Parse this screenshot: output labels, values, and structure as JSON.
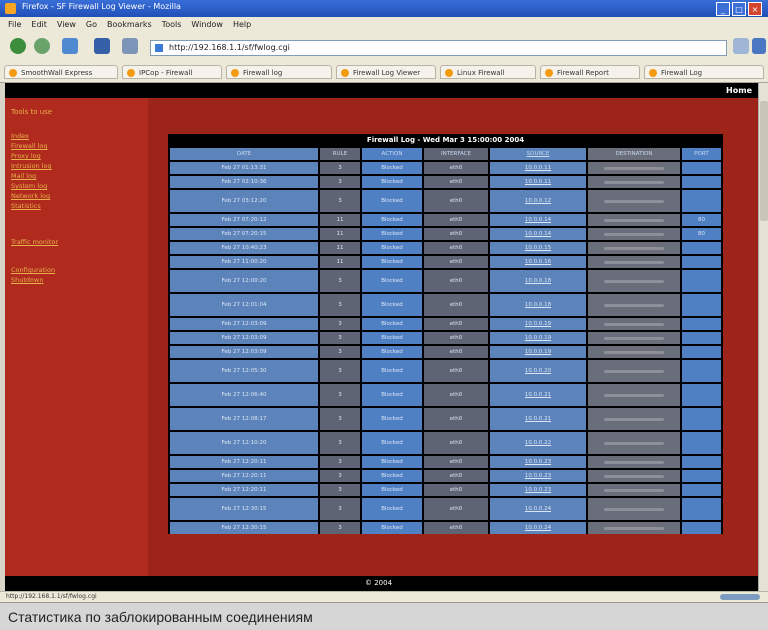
{
  "window": {
    "title": "Firefox - SF Firewall Log Viewer - Mozilla",
    "buttons": [
      "_",
      "□",
      "×"
    ]
  },
  "menu": [
    "File",
    "Edit",
    "View",
    "Go",
    "Bookmarks",
    "Tools",
    "Window",
    "Help"
  ],
  "address_bar": {
    "url": "http://192.168.1.1/sf/fwlog.cgi"
  },
  "tabs": [
    "SmoothWall Express",
    "IPCop - Firewall",
    "Firewall log",
    "Firewall Log Viewer",
    "Linux Firewall",
    "Firewall Report",
    "Firewall Log"
  ],
  "page": {
    "home_link": "Home",
    "sidebar_heading": "Tools to use",
    "sidebar_links": [
      "Index",
      "Firewall log",
      "Proxy log",
      "Intrusion log",
      "Mail log",
      "System log",
      "Network log",
      "Statistics",
      "Traffic monitor",
      "Configuration",
      "Shutdown"
    ],
    "log_title": "Firewall Log - Wed Mar 3 15:00:00 2004",
    "columns": [
      "DATE",
      "RULE",
      "ACTION",
      "INTERFACE",
      "SOURCE",
      "DESTINATION",
      "PORT"
    ],
    "rows": [
      {
        "date": "Feb 27 01:13:31",
        "rule": "3",
        "action": "Blocked",
        "iface": "eth0",
        "src": "10.0.0.11",
        "port": "",
        "tall": false
      },
      {
        "date": "Feb 27 02:10:36",
        "rule": "3",
        "action": "Blocked",
        "iface": "eth0",
        "src": "10.0.0.11",
        "port": "",
        "tall": false
      },
      {
        "date": "Feb 27 03:12:20",
        "rule": "3",
        "action": "Blocked",
        "iface": "eth0",
        "src": "10.0.0.12",
        "port": "",
        "tall": true
      },
      {
        "date": "Feb 27 07:20:12",
        "rule": "11",
        "action": "Blocked",
        "iface": "eth0",
        "src": "10.0.0.14",
        "port": "80",
        "tall": false
      },
      {
        "date": "Feb 27 07:20:15",
        "rule": "11",
        "action": "Blocked",
        "iface": "eth0",
        "src": "10.0.0.14",
        "port": "80",
        "tall": false
      },
      {
        "date": "Feb 27 10:40:23",
        "rule": "11",
        "action": "Blocked",
        "iface": "eth0",
        "src": "10.0.0.15",
        "port": "",
        "tall": false
      },
      {
        "date": "Feb 27 11:00:20",
        "rule": "11",
        "action": "Blocked",
        "iface": "eth0",
        "src": "10.0.0.16",
        "port": "",
        "tall": false
      },
      {
        "date": "Feb 27 12:00:20",
        "rule": "3",
        "action": "Blocked",
        "iface": "eth0",
        "src": "10.0.0.18",
        "port": "",
        "tall": true
      },
      {
        "date": "Feb 27 12:01:04",
        "rule": "3",
        "action": "Blocked",
        "iface": "eth0",
        "src": "10.0.0.18",
        "port": "",
        "tall": true
      },
      {
        "date": "Feb 27 12:03:09",
        "rule": "3",
        "action": "Blocked",
        "iface": "eth0",
        "src": "10.0.0.19",
        "port": "",
        "tall": false
      },
      {
        "date": "Feb 27 12:03:09",
        "rule": "3",
        "action": "Blocked",
        "iface": "eth0",
        "src": "10.0.0.19",
        "port": "",
        "tall": false
      },
      {
        "date": "Feb 27 12:03:09",
        "rule": "3",
        "action": "Blocked",
        "iface": "eth0",
        "src": "10.0.0.19",
        "port": "",
        "tall": false
      },
      {
        "date": "Feb 27 12:05:30",
        "rule": "3",
        "action": "Blocked",
        "iface": "eth0",
        "src": "10.0.0.20",
        "port": "",
        "tall": true
      },
      {
        "date": "Feb 27 12:06:40",
        "rule": "3",
        "action": "Blocked",
        "iface": "eth0",
        "src": "10.0.0.21",
        "port": "",
        "tall": true
      },
      {
        "date": "Feb 27 12:08:17",
        "rule": "3",
        "action": "Blocked",
        "iface": "eth0",
        "src": "10.0.0.21",
        "port": "",
        "tall": true
      },
      {
        "date": "Feb 27 12:10:20",
        "rule": "3",
        "action": "Blocked",
        "iface": "eth0",
        "src": "10.0.0.22",
        "port": "",
        "tall": true
      },
      {
        "date": "Feb 27 12:20:11",
        "rule": "3",
        "action": "Blocked",
        "iface": "eth0",
        "src": "10.0.0.23",
        "port": "",
        "tall": false
      },
      {
        "date": "Feb 27 12:20:11",
        "rule": "3",
        "action": "Blocked",
        "iface": "eth0",
        "src": "10.0.0.23",
        "port": "",
        "tall": false
      },
      {
        "date": "Feb 27 12:20:11",
        "rule": "3",
        "action": "Blocked",
        "iface": "eth0",
        "src": "10.0.0.23",
        "port": "",
        "tall": false
      },
      {
        "date": "Feb 27 12:30:15",
        "rule": "3",
        "action": "Blocked",
        "iface": "eth0",
        "src": "10.0.0.24",
        "port": "",
        "tall": true
      },
      {
        "date": "Feb 27 12:30:15",
        "rule": "3",
        "action": "Blocked",
        "iface": "eth0",
        "src": "10.0.0.24",
        "port": "",
        "tall": false
      }
    ],
    "footer": "© 2004"
  },
  "status_bar": {
    "text": "http://192.168.1.1/sf/fwlog.cgi"
  },
  "caption": "Статистика по заблокированным соединениям",
  "colors": {
    "page_bg": "#b02a1e",
    "link": "#e7b14a",
    "cell_blue": "#5d84ba",
    "cell_gray": "#5f6475"
  }
}
